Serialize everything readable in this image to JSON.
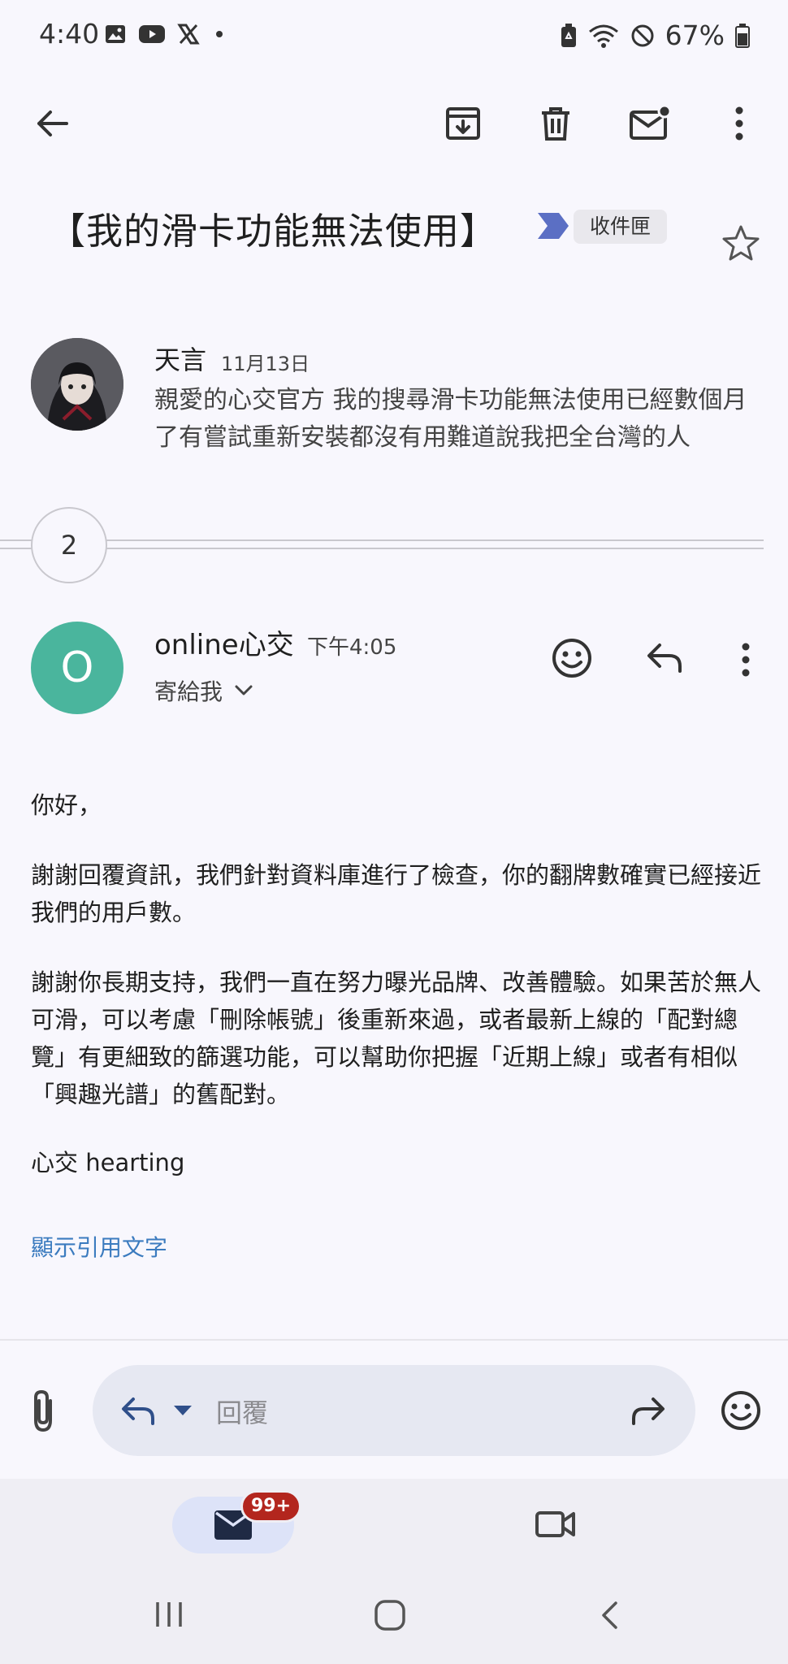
{
  "status_bar": {
    "time": "4:40",
    "battery": "67%",
    "left_icons": [
      "gallery-icon",
      "youtube-icon",
      "x-icon",
      "dot-icon"
    ],
    "right_icons": [
      "battery-saver-icon",
      "wifi-icon",
      "do-not-disturb-icon",
      "battery-icon"
    ]
  },
  "toolbar": {
    "icons": [
      "back-arrow-icon",
      "archive-icon",
      "delete-icon",
      "mark-unread-icon",
      "more-vert-icon"
    ]
  },
  "email": {
    "subject": "【我的滑卡功能無法使用】",
    "label": "收件匣",
    "thread_count": "2"
  },
  "first_message": {
    "sender": "天言",
    "date": "11月13日",
    "snippet": "親愛的心交官方 我的搜尋滑卡功能無法使用已經數個月了有嘗試重新安裝都沒有用難道說我把全台灣的人"
  },
  "second_message": {
    "avatar_letter": "O",
    "sender": "online心交",
    "time": "下午4:05",
    "recipient": "寄給我",
    "body": [
      "你好，",
      "謝謝回覆資訊，我們針對資料庫進行了檢查，你的翻牌數確實已經接近我們的用戶數。",
      "謝謝你長期支持，我們一直在努力曝光品牌、改善體驗。如果苦於無人可滑，可以考慮「刪除帳號」後重新來過，或者最新上線的「配對總覽」有更細致的篩選功能，可以幫助你把握「近期上線」或者有相似「興趣光譜」的舊配對。",
      "心交 hearting"
    ],
    "show_quoted": "顯示引用文字"
  },
  "reply_bar": {
    "placeholder": "回覆"
  },
  "bottom_nav": {
    "badge": "99+"
  },
  "colors": {
    "background": "#f8f7fd",
    "avatar_teal": "#4ab59d",
    "label_arrow": "#5b6fc4",
    "badge_red": "#b3261e",
    "link_blue": "#3b7bbf",
    "reply_pill": "#e6e8f2"
  }
}
